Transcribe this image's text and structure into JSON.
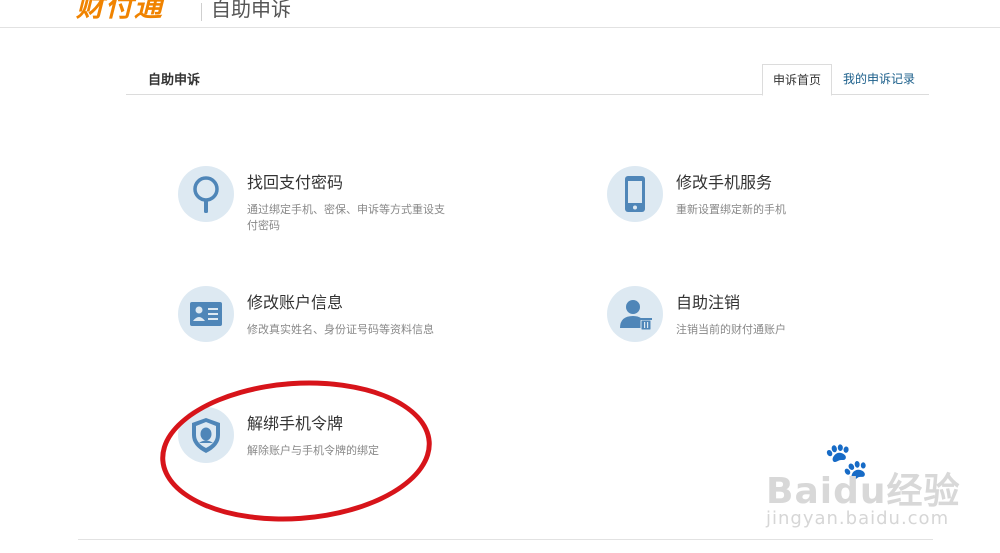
{
  "header": {
    "logo": "财付通",
    "title": "自助申诉"
  },
  "panel": {
    "title": "自助申诉",
    "tabs": [
      {
        "label": "申诉首页"
      },
      {
        "label": "我的申诉记录"
      }
    ]
  },
  "items": [
    {
      "title": "找回支付密码",
      "desc": "通过绑定手机、密保、申诉等方式重设支付密码",
      "icon": "magnifier-icon"
    },
    {
      "title": "修改手机服务",
      "desc": "重新设置绑定新的手机",
      "icon": "mobile-phone-icon"
    },
    {
      "title": "修改账户信息",
      "desc": "修改真实姓名、身份证号码等资料信息",
      "icon": "id-card-icon"
    },
    {
      "title": "自助注销",
      "desc": "注销当前的财付通账户",
      "icon": "user-delete-icon"
    },
    {
      "title": "解绑手机令牌",
      "desc": "解除账户与手机令牌的绑定",
      "icon": "shield-token-icon"
    }
  ],
  "watermark": {
    "brand": "Baidu经验",
    "url": "jingyan.baidu.com"
  },
  "colors": {
    "accent_orange": "#f08300",
    "icon_blue": "#4f86b8",
    "annotation_red": "#d7141a"
  }
}
